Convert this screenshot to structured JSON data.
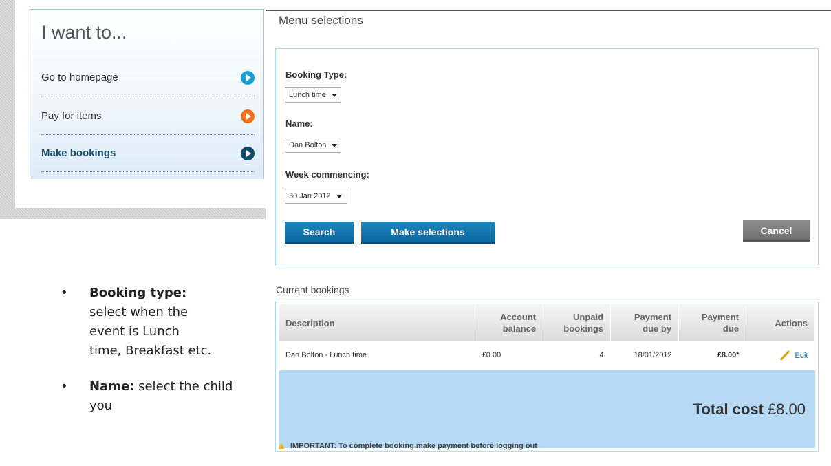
{
  "iwant": {
    "title": "I want to...",
    "items": [
      {
        "label": "Go to homepage",
        "icon": "play-circle-icon",
        "color": "#1a9fd7"
      },
      {
        "label": "Pay for items",
        "icon": "play-circle-icon",
        "color": "#f26e1b"
      },
      {
        "label": "Make bookings",
        "icon": "play-circle-icon",
        "color": "#124a6d"
      }
    ]
  },
  "notes": [
    {
      "term": "Booking type:",
      "desc": "select when the event is Lunch time, Breakfast etc."
    },
    {
      "term": "Name:",
      "desc": "select the child you"
    }
  ],
  "menu": {
    "heading": "Menu selections",
    "booking_type_label": "Booking Type:",
    "booking_type_value": "Lunch time",
    "name_label": "Name:",
    "name_value": "Dan Bolton",
    "week_label": "Week commencing:",
    "week_value": "30 Jan 2012",
    "search_button": "Search",
    "make_selections_button": "Make selections",
    "cancel_button": "Cancel"
  },
  "bookings": {
    "heading": "Current bookings",
    "columns": {
      "description": "Description",
      "balance_1": "Account",
      "balance_2": "balance",
      "unpaid_1": "Unpaid",
      "unpaid_2": "bookings",
      "dueby_1": "Payment",
      "dueby_2": "due by",
      "due_1": "Payment",
      "due_2": "due",
      "actions": "Actions"
    },
    "rows": [
      {
        "description": "Dan Bolton - Lunch time",
        "balance": "£0.00",
        "unpaid": "4",
        "due_by": "18/01/2012",
        "due": "£8.00*",
        "action": "Edit"
      }
    ],
    "total_label": "Total cost",
    "total_value": "£8.00"
  },
  "important": "IMPORTANT: To complete booking make payment before logging out",
  "colors": {
    "accent": "#0a66a0",
    "panel_border": "#a9dff0",
    "total_band": "#b6d9f5"
  }
}
